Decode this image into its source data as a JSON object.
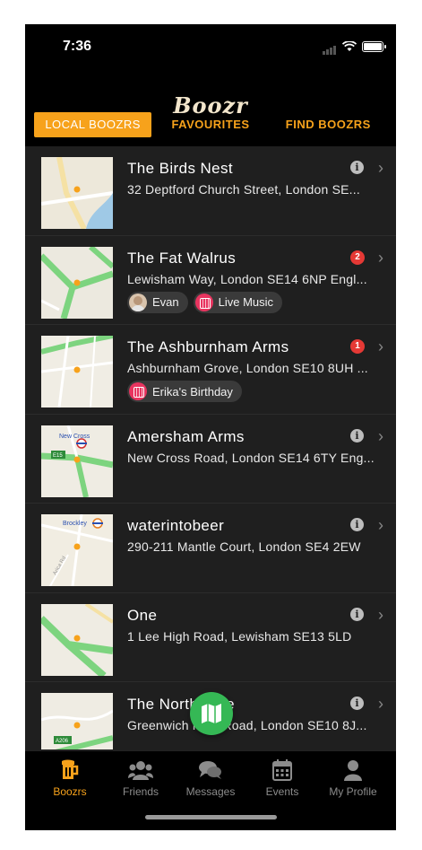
{
  "status": {
    "time": "7:36",
    "battery_level": 1.0
  },
  "header": {
    "logo": "Boozr"
  },
  "tabs": [
    {
      "label": "LOCAL BOOZRS",
      "active": true
    },
    {
      "label": "FAVOURITES",
      "active": false
    },
    {
      "label": "FIND BOOZRS",
      "active": false
    }
  ],
  "pubs": [
    {
      "name": "The Birds Nest",
      "address": "32 Deptford Church Street, London SE...",
      "indicator": "info-icon"
    },
    {
      "name": "The Fat Walrus",
      "address": "Lewisham Way, London SE14 6NP Engl...",
      "indicator": "count",
      "count": "2",
      "chips": [
        {
          "type": "friend",
          "label": "Evan"
        },
        {
          "type": "event",
          "label": "Live Music"
        }
      ]
    },
    {
      "name": "The Ashburnham Arms",
      "address": "Ashburnham Grove, London SE10 8UH ...",
      "indicator": "count",
      "count": "1",
      "chips": [
        {
          "type": "event",
          "label": "Erika's Birthday"
        }
      ]
    },
    {
      "name": "Amersham Arms",
      "address": "New Cross Road, London SE14 6TY Eng...",
      "indicator": "info-icon",
      "map_label": "New Cross",
      "road_label": "E15"
    },
    {
      "name": "waterintobeer",
      "address": "290-211 Mantle Court, London SE4 2EW",
      "indicator": "info-icon",
      "map_label": "Brockley",
      "road_label": "Arica Rd"
    },
    {
      "name": "One",
      "address": "1 Lee High Road, Lewisham SE13 5LD",
      "indicator": "info-icon"
    },
    {
      "name": "The North Pole",
      "address": "Greenwich High Road, London SE10 8J...",
      "indicator": "info-icon",
      "road_label": "A206"
    }
  ],
  "tabbar": [
    {
      "label": "Boozrs",
      "icon": "beer-mug-icon",
      "active": true
    },
    {
      "label": "Friends",
      "icon": "friends-icon",
      "active": false
    },
    {
      "label": "Messages",
      "icon": "messages-icon",
      "active": false
    },
    {
      "label": "Events",
      "icon": "calendar-icon",
      "active": false
    },
    {
      "label": "My Profile",
      "icon": "profile-icon",
      "active": false
    }
  ],
  "colors": {
    "accent": "#f7a21b",
    "map_green": "#35b855",
    "badge_red": "#e53935"
  }
}
